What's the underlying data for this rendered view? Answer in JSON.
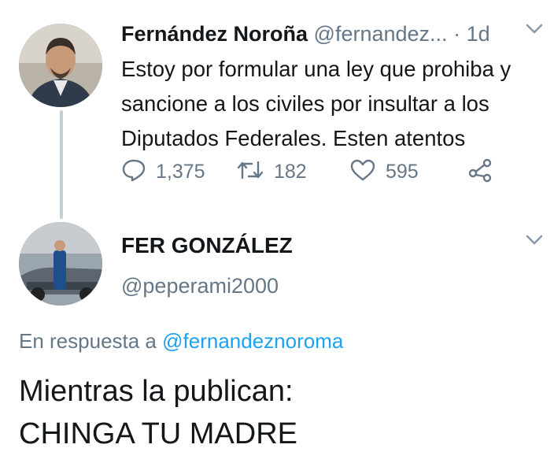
{
  "tweet1": {
    "author_name": "Fernández Noroña",
    "handle": "@fernandez...",
    "time": "· 1d",
    "text_lines": [
      "Estoy por formular una ley que prohiba y",
      "sancione a los civiles por insultar a los",
      "Diputados Federales. Esten atentos"
    ],
    "replies": "1,375",
    "retweets": "182",
    "likes": "595",
    "icons": [
      "reply-icon",
      "retweet-icon",
      "like-icon",
      "share-icon",
      "chevron-down-icon"
    ]
  },
  "tweet2": {
    "author_name": "FER GONZÁLEZ",
    "handle": "@peperami2000",
    "reply_prefix": "En respuesta a",
    "reply_mention": "@fernandeznoroma",
    "text_lines": [
      "Mientras la publican:",
      "CHINGA TU MADRE"
    ]
  },
  "colors": {
    "text": "#14171a",
    "secondary": "#657786",
    "link": "#1da1f2",
    "thread_line": "#c4cfd6"
  }
}
